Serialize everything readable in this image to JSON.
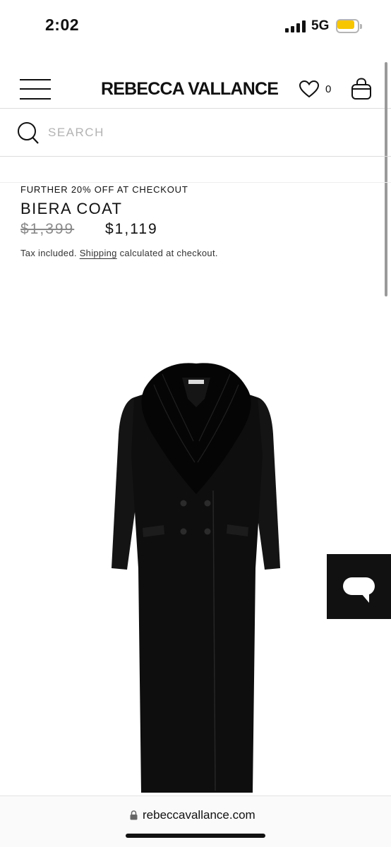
{
  "status_bar": {
    "time": "2:02",
    "network": "5G",
    "battery_color": "#f7c600"
  },
  "header": {
    "logo": "REBECCA VALLANCE",
    "wishlist_count": "0",
    "icons": [
      "menu-icon",
      "heart-icon",
      "bag-icon"
    ]
  },
  "search": {
    "placeholder": "SEARCH",
    "icon": "search-icon"
  },
  "product": {
    "promo": "FURTHER 20% OFF AT CHECKOUT",
    "title": "BIERA COAT",
    "price_original": "$1,399",
    "price_sale": "$1,119",
    "tax_prefix": "Tax included.",
    "shipping_link": "Shipping",
    "tax_suffix": "calculated at checkout."
  },
  "chat": {
    "icon": "chat-bubble-icon"
  },
  "browser": {
    "url": "rebeccavallance.com",
    "icon": "lock-icon"
  }
}
